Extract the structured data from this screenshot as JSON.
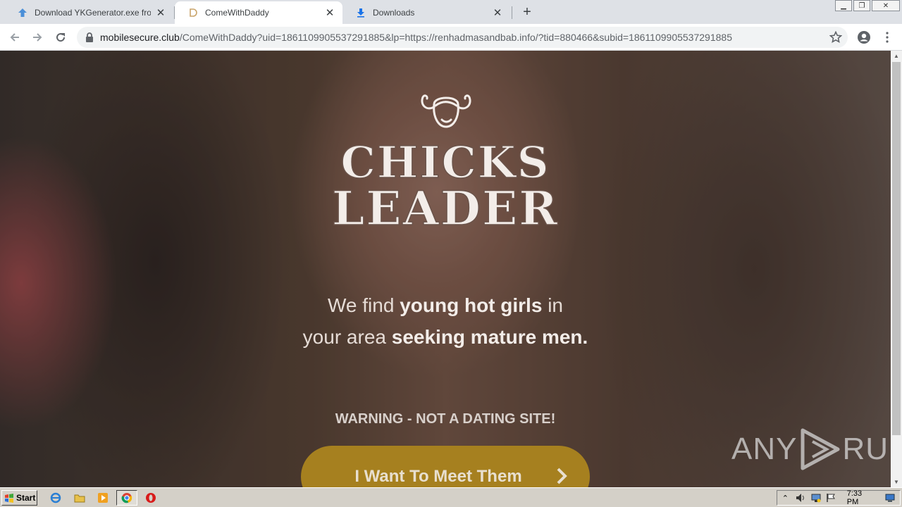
{
  "browser": {
    "tabs": [
      {
        "title": "Download YKGenerator.exe from Se",
        "icon": "upload-arrow-icon",
        "active": false
      },
      {
        "title": "ComeWithDaddy",
        "icon": "d-favicon-icon",
        "active": true
      },
      {
        "title": "Downloads",
        "icon": "download-icon",
        "active": false
      }
    ],
    "address": {
      "host": "mobilesecure.club",
      "path": "/ComeWithDaddy?uid=1861109905537291885&lp=https://renhadmasandbab.info/?tid=880466&subid=1861109905537291885"
    }
  },
  "page": {
    "logo": {
      "line1": "CHICKS",
      "line2": "LEADER"
    },
    "tagline": {
      "line1_pre": "We find ",
      "line1_bold": "young hot girls",
      "line1_post": " in",
      "line2_pre": "your area ",
      "line2_bold": "seeking mature men."
    },
    "warning": "WARNING - NOT A DATING SITE!",
    "cta_label": "I Want To Meet Them"
  },
  "watermark": {
    "left": "ANY",
    "right": "RUN"
  },
  "taskbar": {
    "start_label": "Start",
    "clock": "7:33 PM"
  },
  "colors": {
    "cta_bg": "#a6801f",
    "tab_strip": "#dee1e6",
    "omnibox": "#f1f3f4"
  }
}
